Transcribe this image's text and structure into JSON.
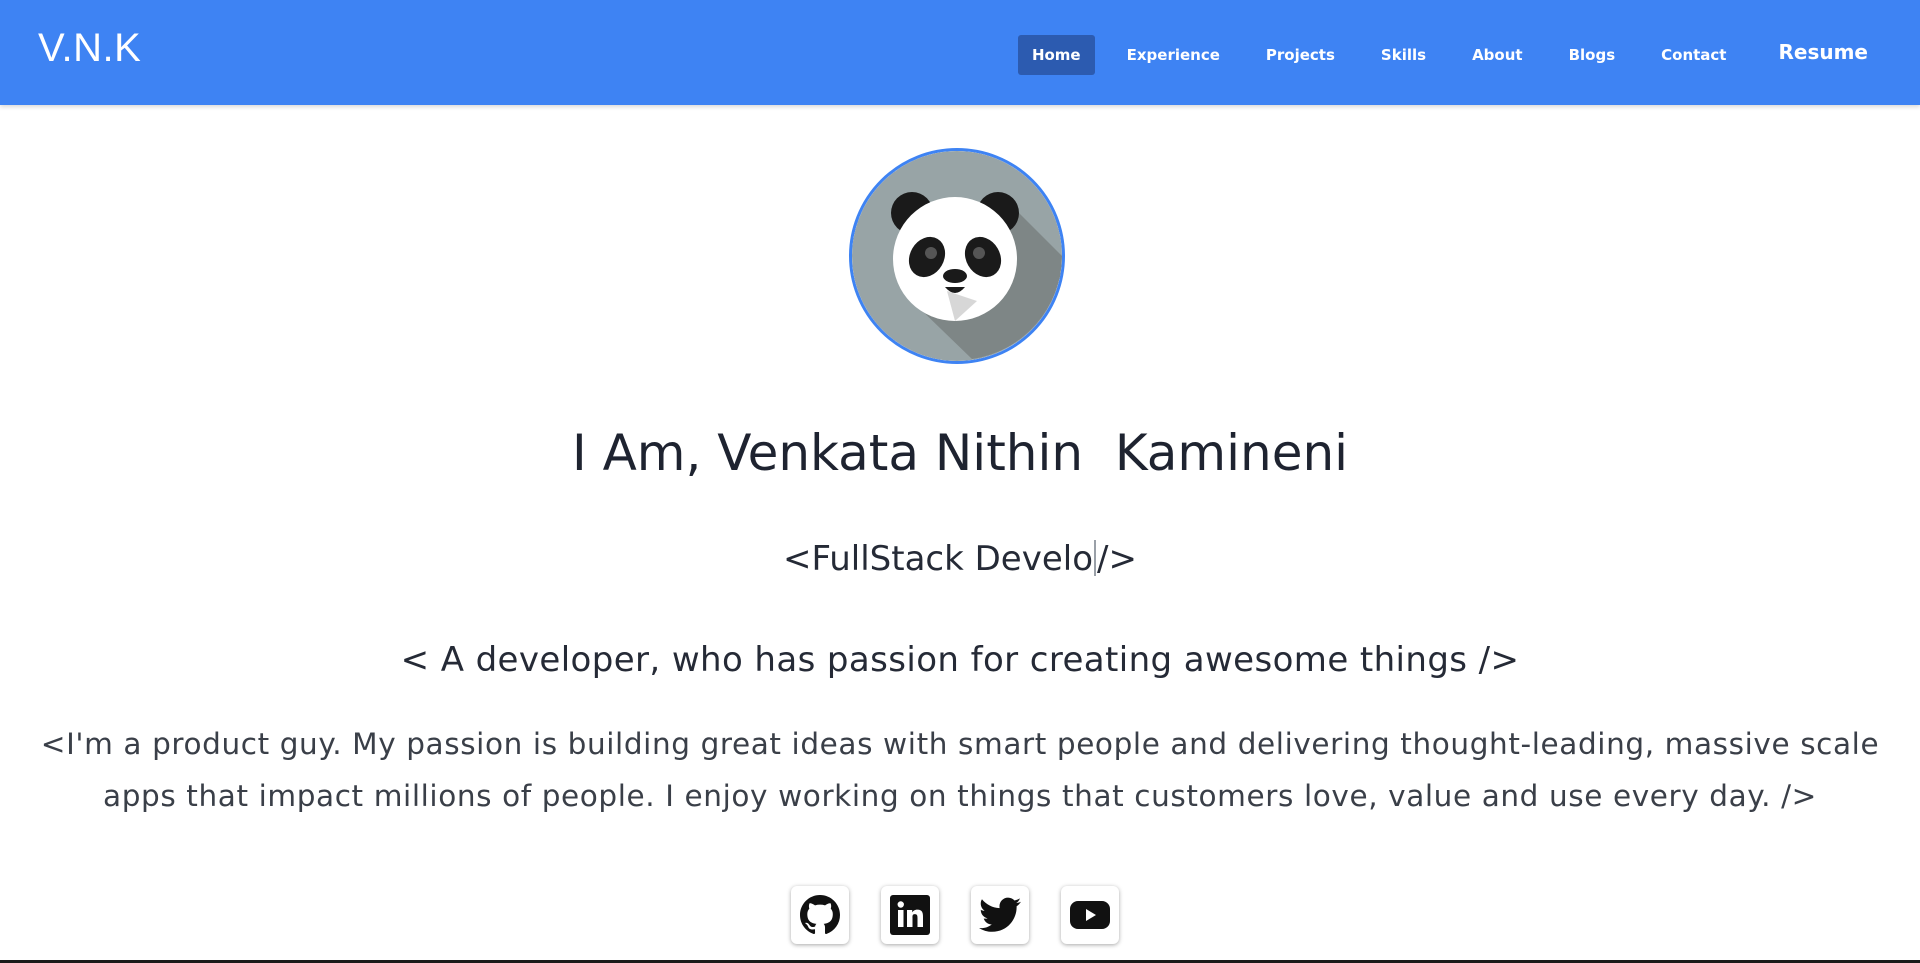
{
  "brand": "V.N.K",
  "nav": {
    "items": [
      {
        "label": "Home",
        "active": true
      },
      {
        "label": "Experience",
        "active": false
      },
      {
        "label": "Projects",
        "active": false
      },
      {
        "label": "Skills",
        "active": false
      },
      {
        "label": "About",
        "active": false
      },
      {
        "label": "Blogs",
        "active": false
      },
      {
        "label": "Contact",
        "active": false
      }
    ],
    "resume": "Resume"
  },
  "hero": {
    "avatar_icon": "panda-avatar",
    "name": "I Am, Venkata Nithin  Kamineni",
    "role_prefix": "<FullStack Develo",
    "role_suffix": "/>",
    "tagline": "< A developer, who has passion for creating awesome things />",
    "bio": "<I'm a product guy. My passion is building great ideas with smart people and delivering thought-leading, massive scale apps that impact millions of people. I enjoy working on things that customers love, value and use every day. />"
  },
  "social": [
    {
      "icon": "github-icon"
    },
    {
      "icon": "linkedin-icon"
    },
    {
      "icon": "twitter-icon"
    },
    {
      "icon": "youtube-icon"
    }
  ],
  "colors": {
    "navbar": "#3e83f3",
    "active_nav": "#2c5bb0",
    "text_dark": "#1e2330"
  }
}
